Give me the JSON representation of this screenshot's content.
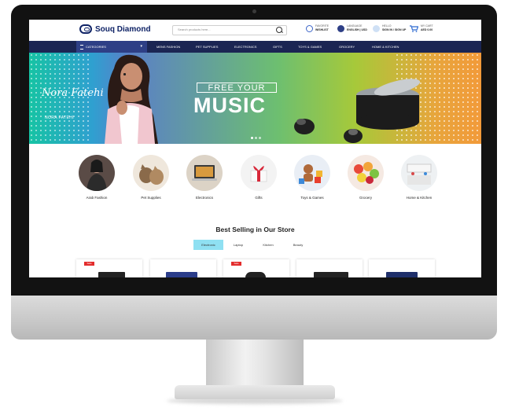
{
  "site": {
    "logo_text": "Souq Diamond",
    "search_placeholder": "Search products here..."
  },
  "header_items": [
    {
      "line1": "FAVORITE",
      "line2": "WISHLIST",
      "color": "#3b64c8",
      "icon": "heart-icon"
    },
    {
      "line1": "LANGUAGE",
      "line2": "ENGLISH | USD",
      "color": "#2e3f86",
      "icon": "globe-icon"
    },
    {
      "line1": "HELLO",
      "line2": "SIGN IN / SIGN UP",
      "color": "#4a90d9",
      "icon": "user-icon"
    },
    {
      "line1": "MY CART",
      "line2": "AED 0.00",
      "color": "#2e6ad1",
      "icon": "cart-icon"
    }
  ],
  "nav": {
    "categories_label": "CATEGORIES",
    "links": [
      "MENS FASHION",
      "PET SUPPLIES",
      "ELECTRONICS",
      "GIFTS",
      "TOYS & GAMES",
      "GROCERY",
      "HOME & KITCHEN"
    ]
  },
  "banner": {
    "signature": "Nora Fatehi",
    "name": "NORA FATEHI",
    "headline_top": "FREE YOUR",
    "headline_main": "MUSIC",
    "slides": 3,
    "active_slide": 1
  },
  "categories": [
    {
      "label": "Arab Fashion",
      "icon": "fashion-icon",
      "bg": "#5a4b46"
    },
    {
      "label": "Pet Supplies",
      "icon": "pets-icon",
      "bg": "#efe7dc"
    },
    {
      "label": "Electronics",
      "icon": "laptop-icon",
      "bg": "#dcd3c6"
    },
    {
      "label": "Gifts",
      "icon": "gift-icon",
      "bg": "#f3f3f3"
    },
    {
      "label": "Toys & Games",
      "icon": "toys-icon",
      "bg": "#e9eef5"
    },
    {
      "label": "Grocery",
      "icon": "grocery-icon",
      "bg": "#f5e9e2"
    },
    {
      "label": "Home & Kitchen",
      "icon": "kitchen-icon",
      "bg": "#eef1f3"
    }
  ],
  "best_selling": {
    "title": "Best Selling in Our Store",
    "tabs": [
      "Electronic",
      "Laptop",
      "Kitchen",
      "Beauty"
    ],
    "active_tab": 0,
    "sale_tag": "Sale"
  }
}
